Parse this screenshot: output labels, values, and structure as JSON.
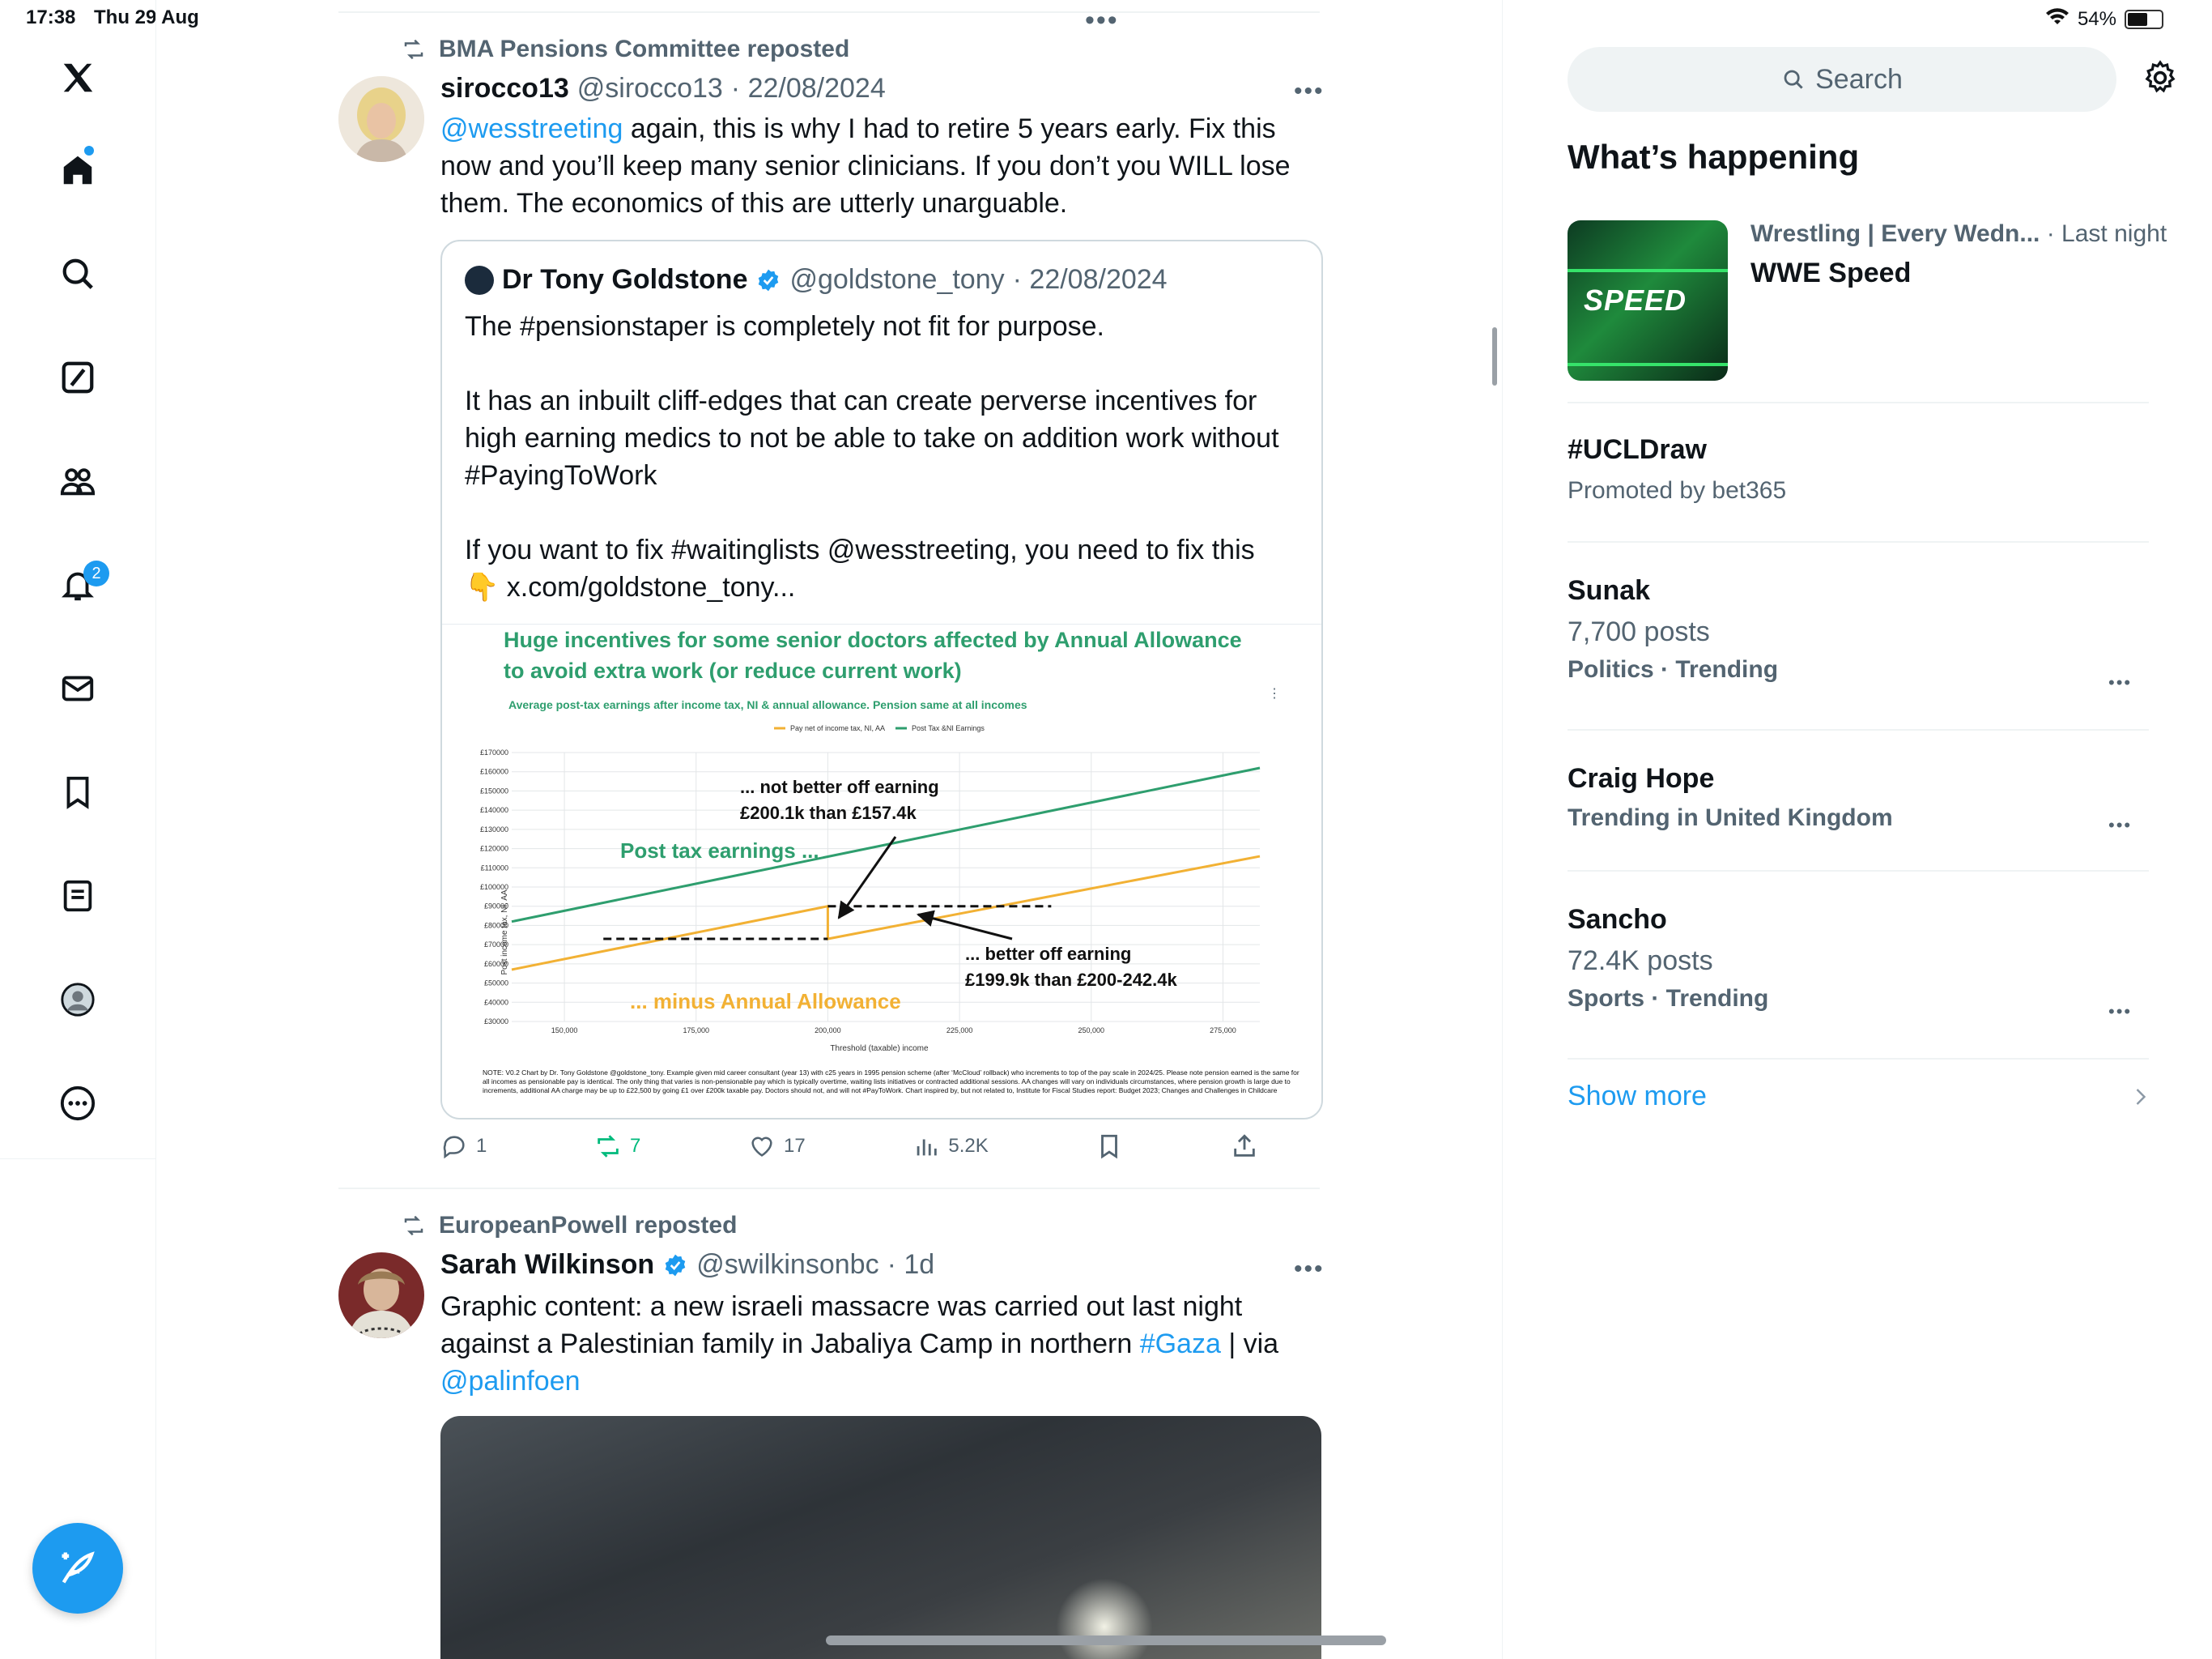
{
  "status_bar": {
    "time": "17:38",
    "date": "Thu 29 Aug",
    "battery": "54%"
  },
  "nav": {
    "notifications_count": "2"
  },
  "feed": {
    "post1": {
      "repost_label": "BMA Pensions Committee reposted",
      "name": "sirocco13",
      "handle": "@sirocco13",
      "date": "· 22/08/2024",
      "mention": "@wesstreeting",
      "text_1": " again, this is why I had to retire 5 years early. Fix this",
      "text_2": "now and you’ll keep many senior clinicians. If you don’t you WILL lose",
      "text_3": "them. The economics of this are utterly unarguable.",
      "quote": {
        "name": "Dr Tony Goldstone",
        "handle": "@goldstone_tony",
        "date": "· 22/08/2024",
        "line_1": "The #pensionstaper is completely not fit for purpose.",
        "line_2": "It has an inbuilt cliff-edges that can create perverse incentives for",
        "line_3": "high earning medics to not be able to take on addition work without",
        "line_4": "#PayingToWork",
        "line_5": "If you want to fix #waitinglists @wesstreeting, you need to fix this",
        "line_6": "x.com/goldstone_tony...",
        "line_6_emoji": "👇"
      },
      "actions": {
        "replies": "1",
        "reposts": "7",
        "likes": "17",
        "views": "5.2K"
      }
    },
    "post2": {
      "repost_label": "EuropeanPowell reposted",
      "name": "Sarah Wilkinson",
      "handle": "@swilkinsonbc",
      "date": "· 1d",
      "text_1": "Graphic content: a new israeli massacre was carried out last night",
      "text_2a": "against a Palestinian family in Jabaliya Camp in northern ",
      "hashtag": "#Gaza",
      "text_2b": " | via",
      "mention": "@palinfoen"
    }
  },
  "chart_data": {
    "type": "line",
    "title": "Huge incentives for some senior doctors affected by Annual Allowance to avoid extra work (or reduce current work)",
    "subtitle": "Average post-tax earnings after income tax, NI & annual allowance. Pension same at all incomes",
    "xlabel": "Threshold (taxable) income",
    "ylabel": "Post income tax, NI, AA",
    "x_ticks": [
      "150,000",
      "175,000",
      "200,000",
      "225,000",
      "250,000",
      "275,000"
    ],
    "y_ticks": [
      "£30000",
      "£40000",
      "£50000",
      "£60000",
      "£70000",
      "£80000",
      "£90000",
      "£100000",
      "£110000",
      "£120000",
      "£130000",
      "£140000",
      "£150000",
      "£160000",
      "£170000"
    ],
    "xlim": [
      140000,
      282000
    ],
    "ylim": [
      30000,
      170000
    ],
    "series": [
      {
        "name": "Post Tax &NI Earnings",
        "color": "#2e9e6e",
        "x": [
          140000,
          282000
        ],
        "y": [
          82000,
          162000
        ]
      },
      {
        "name": "Pay net of income tax, NI, AA",
        "color": "#f2b134",
        "x": [
          140000,
          200000,
          200000,
          282000
        ],
        "y": [
          57000,
          90000,
          73000,
          116000
        ]
      }
    ],
    "annotations": [
      {
        "text": "... not better off earning",
        "text2": "£200.1k than £157.4k"
      },
      {
        "text": "Post tax earnings ..."
      },
      {
        "text": "... better off earning",
        "text2": "£199.9k than £200-242.4k"
      },
      {
        "text": "... minus Annual Allowance"
      }
    ],
    "note": "NOTE: V0.2 Chart by Dr. Tony Goldstone @goldstone_tony. Example given mid career consultant (year 13) with c25 years in 1995 pension scheme (after ‘McCloud’ rollback) who increments to top of the pay scale in 2024/25. Please note pension earned is the same for all incomes as pensionable pay is identical. The only thing that varies is non-pensionable pay which is typically overtime, waiting lists initiatives or contracted additional sessions. AA changes will vary on individuals circumstances, where pension growth is large due to increments, additional AA charge may be up to £22,500 by going £1 over £200k taxable pay. Doctors should not, and will not #PayToWork. Chart inspired by, but not related to, Institute for Fiscal Studies report: Budget 2023; Changes and Challenges in Childcare"
  },
  "sidebar": {
    "search_placeholder": "Search",
    "section_title": "What’s happening",
    "event": {
      "category": "Wrestling | Every Wedn...",
      "time": "· Last night",
      "title": "WWE Speed",
      "image_text": "SPEED"
    },
    "trends": [
      {
        "title": "#UCLDraw",
        "sub": "Promoted by bet365"
      },
      {
        "title": "Sunak",
        "sub": "7,700 posts",
        "meta": "Politics · Trending"
      },
      {
        "title": "Craig Hope",
        "meta": "Trending in United Kingdom"
      },
      {
        "title": "Sancho",
        "sub": "72.4K posts",
        "meta": "Sports · Trending"
      }
    ],
    "show_more": "Show more"
  }
}
